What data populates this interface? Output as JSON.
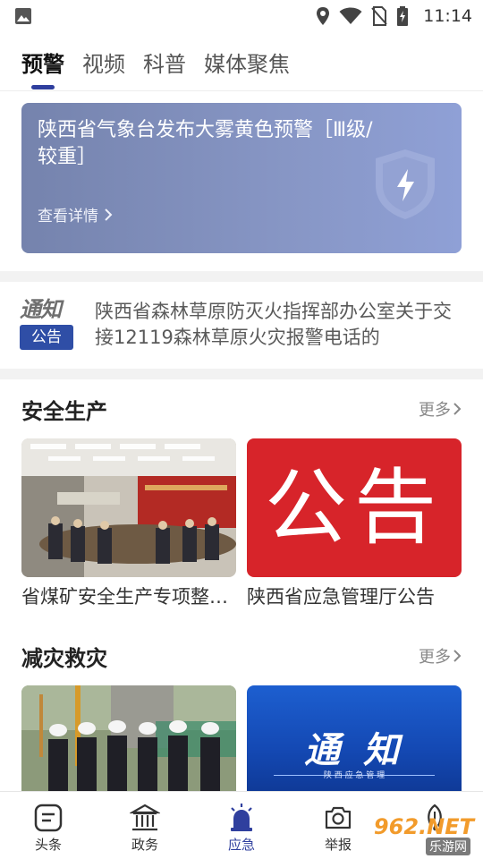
{
  "status_bar": {
    "time": "11:14"
  },
  "tabs": [
    {
      "label": "预警"
    },
    {
      "label": "视频"
    },
    {
      "label": "科普"
    },
    {
      "label": "媒体聚焦"
    }
  ],
  "warning": {
    "title": "陕西省气象台发布大雾黄色预警［Ⅲ级/较重］",
    "detail_label": "查看详情"
  },
  "notice": {
    "logo_top": "通知",
    "logo_badge": "公告",
    "text": "陕西省森林草原防灭火指挥部办公室关于交接12119森林草原火灾报警电话的"
  },
  "sections": [
    {
      "title": "安全生产",
      "more_label": "更多",
      "items": [
        {
          "caption": "省煤矿安全生产专项整治三年行动",
          "thumb": "meeting-photo"
        },
        {
          "caption": "陕西省应急管理厅公告",
          "thumb": "announcement-banner",
          "thumb_text": "公告"
        }
      ]
    },
    {
      "title": "减灾救灾",
      "more_label": "更多",
      "items": [
        {
          "caption": "",
          "thumb": "site-inspection-photo"
        },
        {
          "caption": "",
          "thumb": "notice-banner",
          "thumb_text": "通 知",
          "thumb_subtext": "陕 西 应 急 管 理"
        }
      ]
    }
  ],
  "bottom_nav": [
    {
      "label": "头条",
      "icon": "headline-icon"
    },
    {
      "label": "政务",
      "icon": "government-icon"
    },
    {
      "label": "应急",
      "icon": "siren-icon"
    },
    {
      "label": "举报",
      "icon": "camera-icon"
    },
    {
      "label": "",
      "icon": "leaf-icon"
    }
  ],
  "watermark": {
    "text": "962.NET",
    "subtext": "乐游网"
  },
  "colors": {
    "accent": "#2f3f9e",
    "warning_bg": "#8796c5",
    "announcement_red": "#d7242a"
  }
}
